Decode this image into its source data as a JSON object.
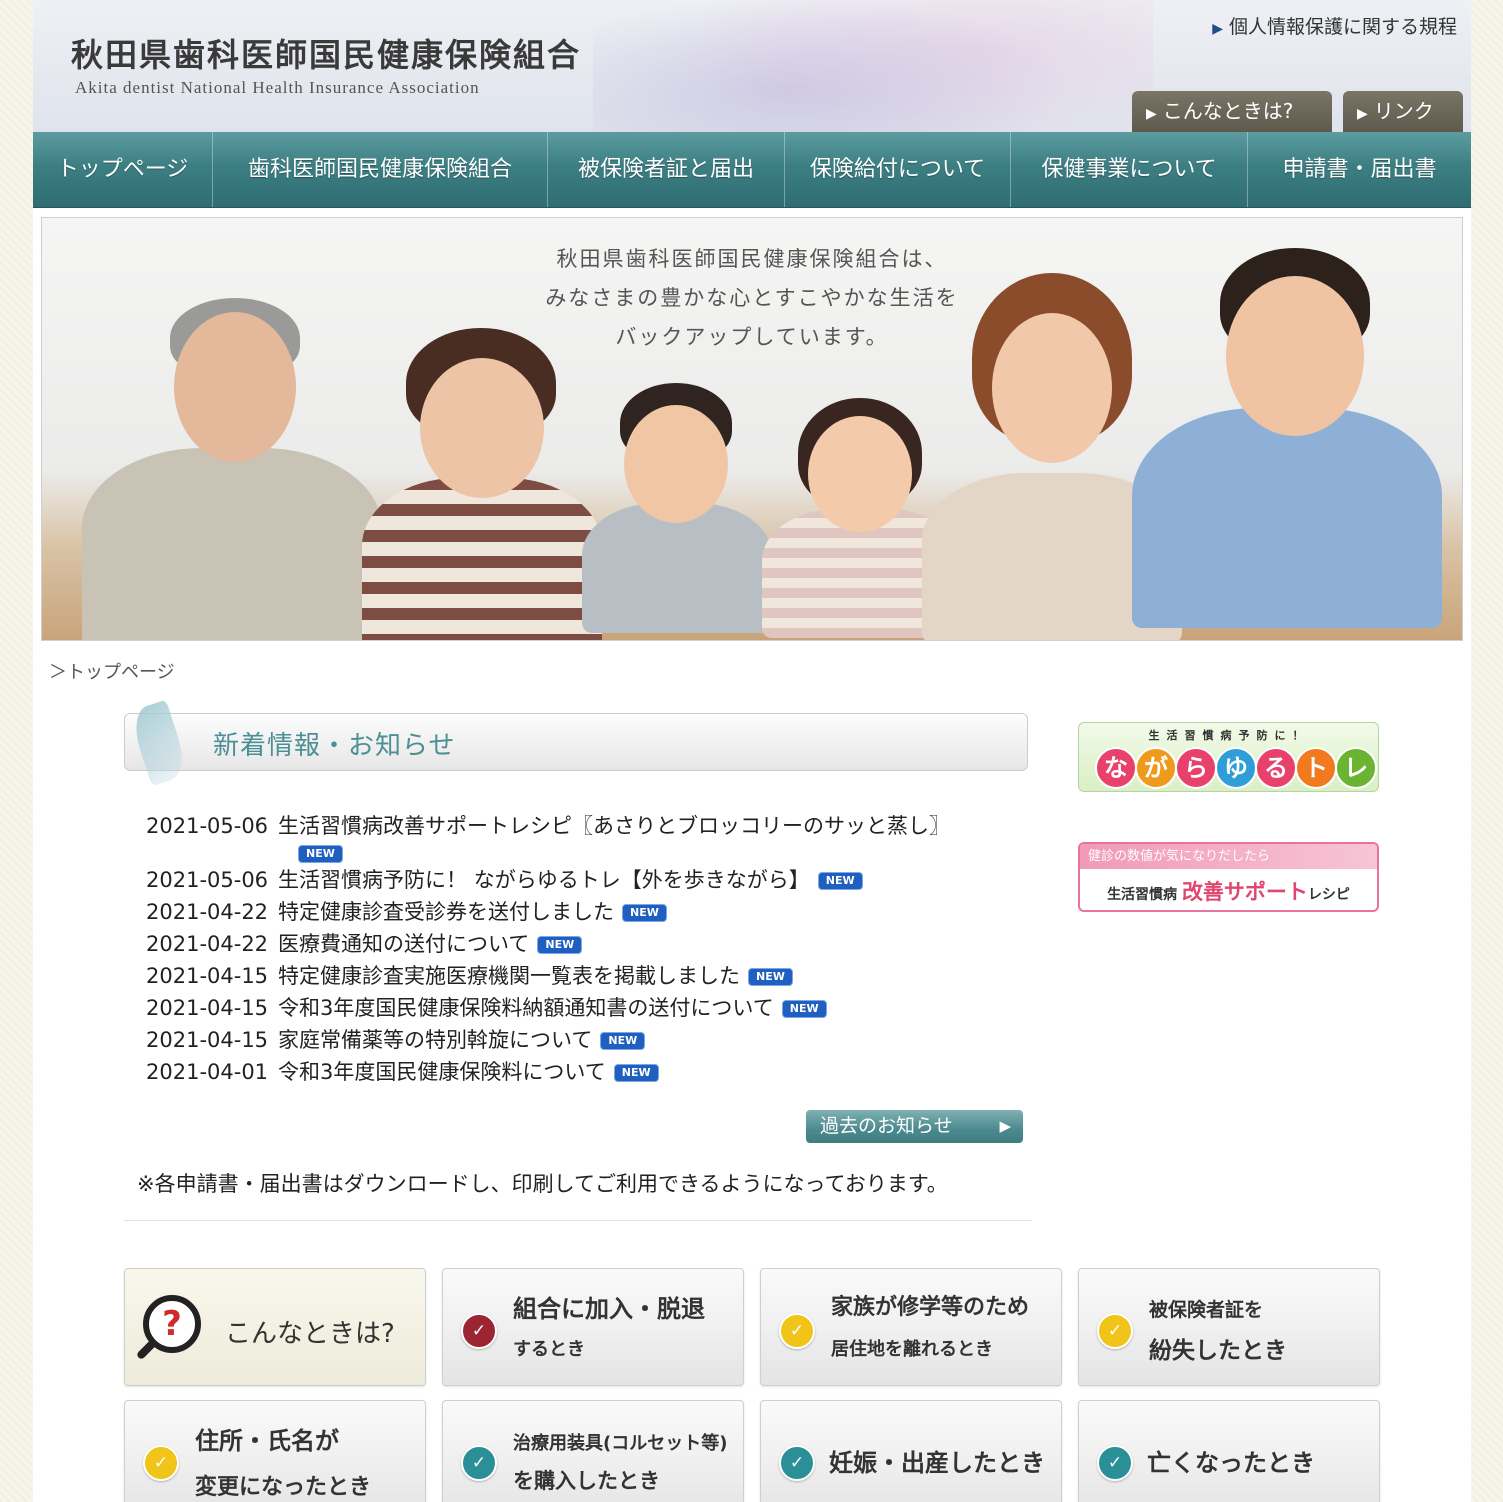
{
  "header": {
    "logo_jp": "秋田県歯科医師国民健康保険組合",
    "logo_en": "Akita dentist National Health Insurance Association",
    "privacy_link": "個人情報保護に関する規程",
    "tab_when": "こんなときは?",
    "tab_link": "リンク"
  },
  "nav": {
    "items": [
      "トップページ",
      "歯科医師国民健康保険組合",
      "被保険者証と届出",
      "保険給付について",
      "保健事業について",
      "申請書・届出書"
    ]
  },
  "hero": {
    "line1": "秋田県歯科医師国民健康保険組合は、",
    "line2": "みなさまの豊かな心とすこやかな生活を",
    "line3": "バックアップしています。"
  },
  "breadcrumb": "＞トップページ",
  "news": {
    "title": "新着情報・お知らせ",
    "badge": "NEW",
    "items": [
      {
        "date": "2021-05-06",
        "text": "生活習慣病改善サポートレシピ〖あさりとブロッコリーのサッと蒸し〗"
      },
      {
        "date": "2021-05-06",
        "text": "生活習慣病予防に！ ながらゆるトレ【外を歩きながら】"
      },
      {
        "date": "2021-04-22",
        "text": "特定健康診査受診券を送付しました"
      },
      {
        "date": "2021-04-22",
        "text": "医療費通知の送付について"
      },
      {
        "date": "2021-04-15",
        "text": "特定健康診査実施医療機関一覧表を掲載しました"
      },
      {
        "date": "2021-04-15",
        "text": "令和3年度国民健康保険料納額通知書の送付について"
      },
      {
        "date": "2021-04-15",
        "text": "家庭常備薬等の特別斡旋について"
      },
      {
        "date": "2021-04-01",
        "text": "令和3年度国民健康保険料について"
      }
    ],
    "past_button": "過去のお知らせ",
    "notice": "※各申請書・届出書はダウンロードし、印刷してご利用できるようになっております。"
  },
  "banners": {
    "nagara_small": "生活習慣病予防に！",
    "nagara_chars": [
      "な",
      "が",
      "ら",
      "ゆ",
      "る",
      "ト",
      "レ"
    ],
    "recipe_top": "健診の数値が気になりだしたら",
    "recipe_pre": "生活習慣病",
    "recipe_big": "改善サポート",
    "recipe_post": "レシピ"
  },
  "situations": {
    "main": "こんなときは?",
    "join_line1": "組合に加入・脱退",
    "join_line2": "するとき",
    "family_line1": "家族が修学等のため",
    "family_line2": "居住地を離れるとき",
    "lost_line1": "被保険者証を",
    "lost_line2": "紛失したとき",
    "address_line1": "住所・氏名が",
    "address_line2": "変更になったとき",
    "device_line1": "治療用装具(コルセット等)",
    "device_line2": "を購入したとき",
    "birth": "妊娠・出産したとき",
    "death": "亡くなったとき"
  },
  "colors": {
    "nav_teal": "#3c7f83",
    "accent_teal": "#4c8f95",
    "new_badge": "#1f5fc0",
    "check_red": "#9b2532",
    "check_yellow": "#f0c419",
    "check_teal": "#2a8f96"
  }
}
